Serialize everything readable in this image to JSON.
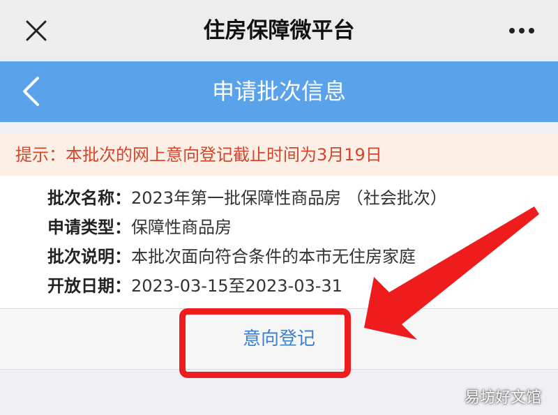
{
  "window": {
    "title": "住房保障微平台",
    "close_icon": "close-icon",
    "more_icon": "more-icon"
  },
  "navbar": {
    "title": "申请批次信息",
    "back_icon": "chevron-left-icon",
    "background_color": "#5aa3ea"
  },
  "notice": {
    "text": "提示：本批次的网上意向登记截止时间为3月19日",
    "color": "#d5452c"
  },
  "batch": {
    "rows": [
      {
        "label": "批次名称：",
        "value": "2023年第一批保障性商品房 （社会批次）"
      },
      {
        "label": "申请类型：",
        "value": "保障性商品房"
      },
      {
        "label": "批次说明：",
        "value": "本批次面向符合条件的本市无住房家庭"
      },
      {
        "label": "开放日期：",
        "value": "2023-03-15至2023-03-31"
      }
    ]
  },
  "actions": {
    "register_label": "意向登记",
    "highlight_color": "#ee1c1c"
  },
  "watermark": {
    "text": "易坊好文馆"
  }
}
